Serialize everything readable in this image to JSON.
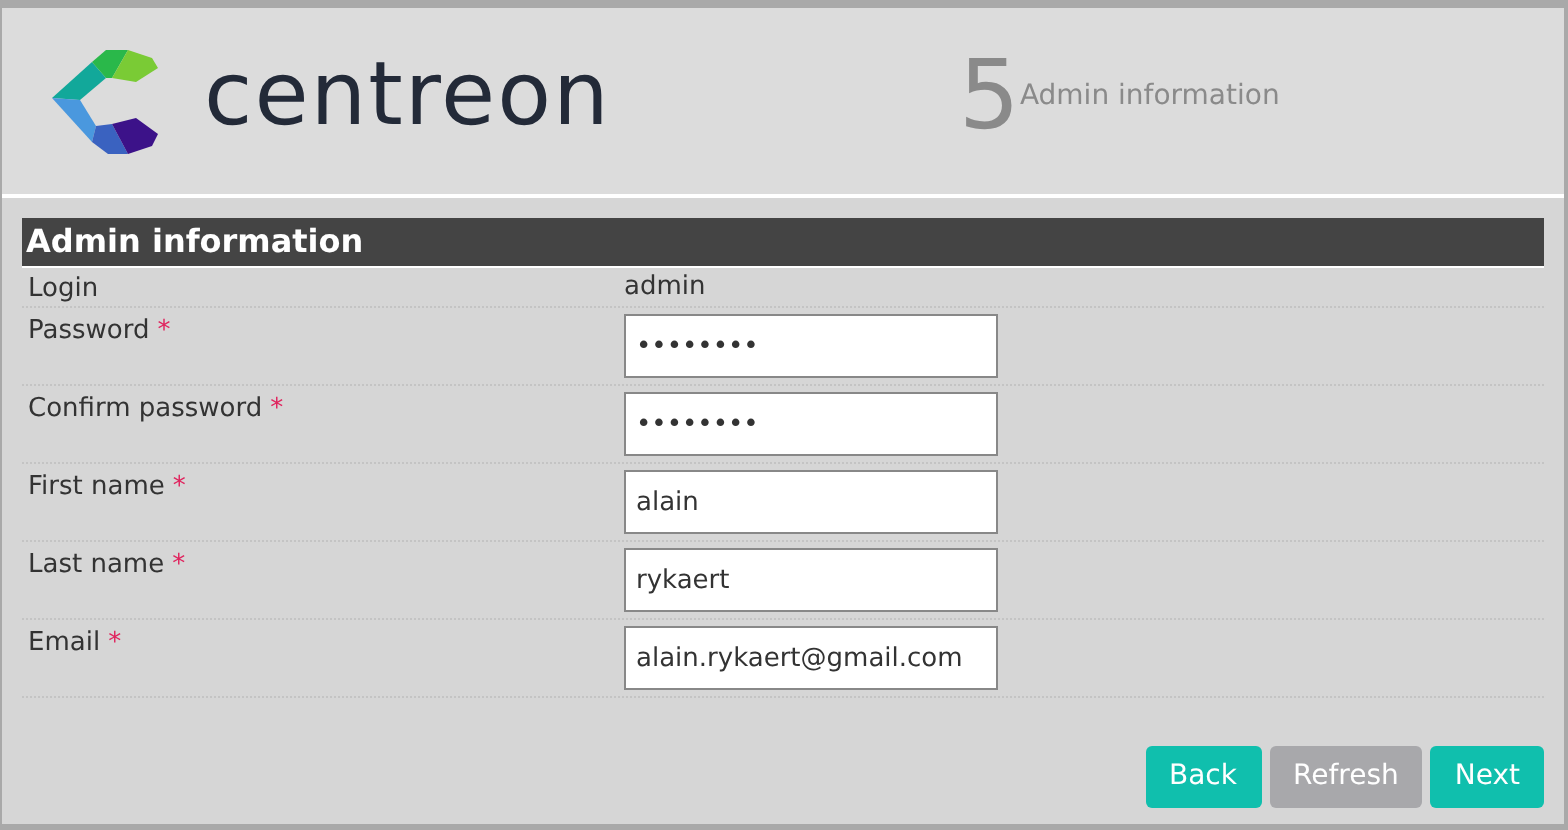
{
  "header": {
    "logo_text": "centreon",
    "step_number": "5",
    "step_title": "Admin information"
  },
  "section": {
    "title": "Admin information"
  },
  "fields": [
    {
      "kind": "static",
      "label": "Login",
      "value": "admin"
    },
    {
      "kind": "input",
      "label": "Password",
      "required_mark": "*",
      "value": "••••••••"
    },
    {
      "kind": "input",
      "label": "Confirm password",
      "required_mark": "*",
      "value": "••••••••"
    },
    {
      "kind": "input",
      "label": "First name",
      "required_mark": "*",
      "value": "alain"
    },
    {
      "kind": "input",
      "label": "Last name",
      "required_mark": "*",
      "value": "rykaert"
    },
    {
      "kind": "input",
      "label": "Email",
      "required_mark": "*",
      "value": "alain.rykaert@gmail.com"
    }
  ],
  "buttons": [
    {
      "label": "Back",
      "disabled": false
    },
    {
      "label": "Refresh",
      "disabled": true
    },
    {
      "label": "Next",
      "disabled": false
    }
  ]
}
